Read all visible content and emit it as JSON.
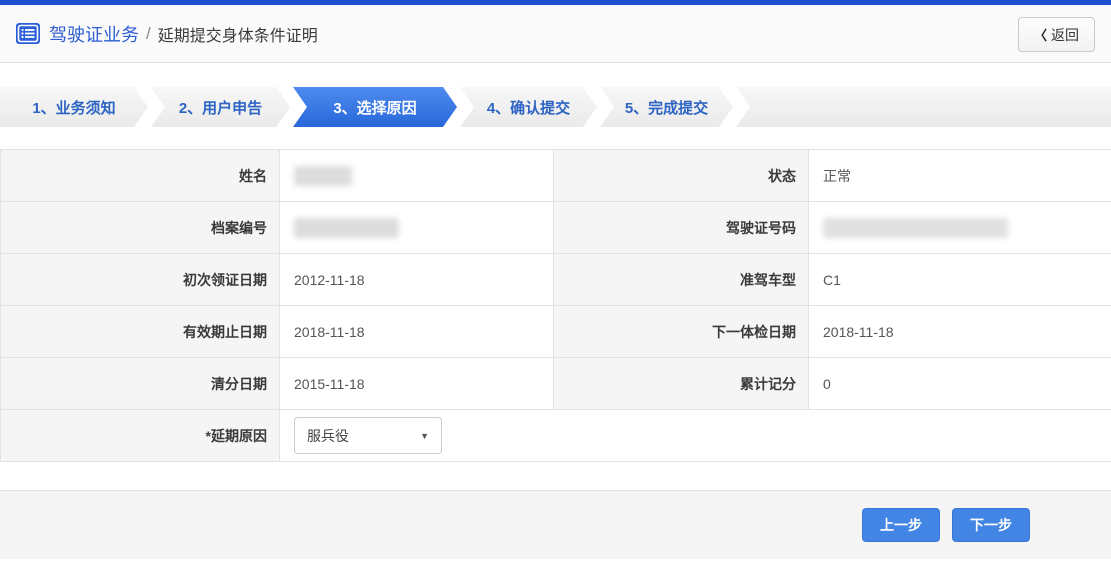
{
  "header": {
    "breadcrumb_primary": "驾驶证业务",
    "breadcrumb_separator": "/",
    "breadcrumb_secondary": "延期提交身体条件证明",
    "back_button": {
      "chevron": "〈",
      "label": "返回"
    }
  },
  "steps": [
    {
      "label": "1、业务须知",
      "active": false
    },
    {
      "label": "2、用户申告",
      "active": false
    },
    {
      "label": "3、选择原因",
      "active": true
    },
    {
      "label": "4、确认提交",
      "active": false
    },
    {
      "label": "5、完成提交",
      "active": false
    }
  ],
  "form": {
    "rows": [
      {
        "left_label": "姓名",
        "left_value": "",
        "left_redacted": true,
        "right_label": "状态",
        "right_value": "正常",
        "right_redacted": false
      },
      {
        "left_label": "档案编号",
        "left_value": "",
        "left_redacted": true,
        "right_label": "驾驶证号码",
        "right_value": "",
        "right_redacted": true
      },
      {
        "left_label": "初次领证日期",
        "left_value": "2012-11-18",
        "left_redacted": false,
        "right_label": "准驾车型",
        "right_value": "C1",
        "right_redacted": false
      },
      {
        "left_label": "有效期止日期",
        "left_value": "2018-11-18",
        "left_redacted": false,
        "right_label": "下一体检日期",
        "right_value": "2018-11-18",
        "right_redacted": false
      },
      {
        "left_label": "清分日期",
        "left_value": "2015-11-18",
        "left_redacted": false,
        "right_label": "累计记分",
        "right_value": "0",
        "right_redacted": false
      }
    ],
    "reason": {
      "label": "*延期原因",
      "selected_option": "服兵役",
      "dropdown_arrow": "▼"
    }
  },
  "footer": {
    "prev_button": "上一步",
    "next_button": "下一步"
  },
  "colors": {
    "top_bar": "#1d4fd0",
    "accent_blue": "#2d5dd4",
    "active_step_gradient_top": "#4e8bef",
    "active_step_gradient_bottom": "#2767d9",
    "step_text": "#2d64c4",
    "primary_button": "#4285e4",
    "label_cell_bg": "#f5f5f5",
    "table_border": "#e2e2e2",
    "status_value": "正常"
  }
}
